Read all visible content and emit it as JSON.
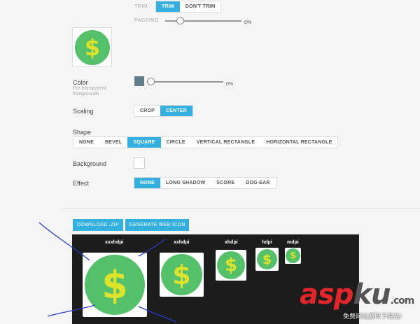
{
  "trim": {
    "label": "TRIM",
    "options": [
      "TRIM",
      "DON'T TRIM"
    ],
    "active": 0
  },
  "padding": {
    "label": "PADDING",
    "value": "0%",
    "level": 0
  },
  "color": {
    "label": "Color",
    "sublabel_line1": "For transparent",
    "sublabel_line2": "foregrounds",
    "swatch": "#607d8b",
    "value": "0%",
    "level": 0
  },
  "scaling": {
    "label": "Scaling",
    "options": [
      "CROP",
      "CENTER"
    ],
    "active": 1
  },
  "shape": {
    "label": "Shape",
    "options": [
      "NONE",
      "BEVEL",
      "SQUARE",
      "CIRCLE",
      "VERTICAL RECTANGLE",
      "HORIZONTAL RECTANGLE"
    ],
    "active": 2
  },
  "background": {
    "label": "Background"
  },
  "effect": {
    "label": "Effect",
    "options": [
      "NONE",
      "LONG SHADOW",
      "SCORE",
      "DOG-EAR"
    ],
    "active": 0
  },
  "actions": {
    "download": "DOWNLOAD .ZIP",
    "web_icon": "GENERATE WEB ICON"
  },
  "densities": [
    "xxxhdpi",
    "xxhdpi",
    "xhdpi",
    "hdpi",
    "mdpi"
  ],
  "icon_glyph": "$",
  "colors": {
    "accent": "#33b0e0",
    "coin": "#55c06a",
    "glyph": "#dde22a"
  },
  "watermark": {
    "main_a": "asp",
    "main_b": "ku",
    "suffix": ".com",
    "sub": "免费网站源码下载站!"
  }
}
